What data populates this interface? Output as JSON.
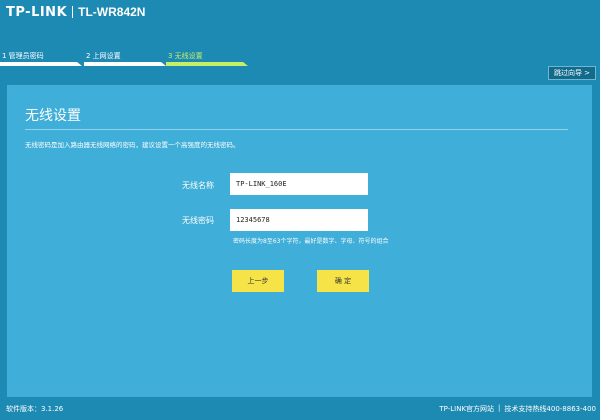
{
  "header": {
    "logo": "TP-LINK",
    "model": "TL-WR842N"
  },
  "steps": [
    {
      "label": "1  管理员密码",
      "active": false
    },
    {
      "label": "2  上网设置",
      "active": false
    },
    {
      "label": "3  无线设置",
      "active": true
    }
  ],
  "skip_button": "跳过向导 >",
  "panel": {
    "title": "无线设置",
    "description": "无线密码是加入路由器无线网络的密码，建议设置一个高强度的无线密码。",
    "ssid_label": "无线名称",
    "ssid_value": "TP-LINK_160E",
    "password_label": "无线密码",
    "password_value": "12345678",
    "password_hint": "密码长度为8至63个字符，最好是数字、字母、符号的组合",
    "prev_button": "上一步",
    "confirm_button": "确 定"
  },
  "footer": {
    "version": "软件版本：3.1.26",
    "official_site": "TP-LINK官方网站",
    "separator": "|",
    "support": "技术支持热线400-8863-400"
  },
  "colors": {
    "background": "#1d8ab3",
    "panel": "#3faed8",
    "active_step": "#c6ef67",
    "button": "#f5e347"
  }
}
